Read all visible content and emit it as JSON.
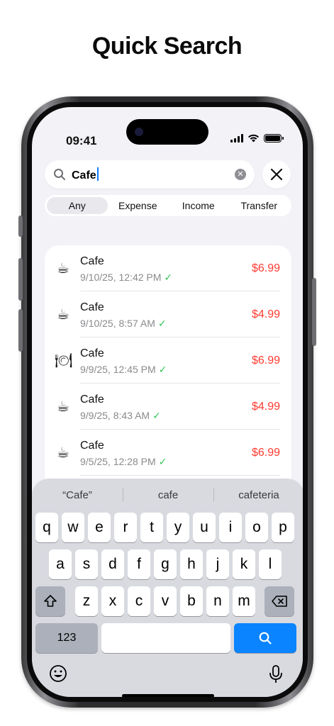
{
  "headline": "Quick Search",
  "status_bar": {
    "time": "09:41"
  },
  "search": {
    "query": "Cafe",
    "clear_icon": "x-circle-icon",
    "close_icon": "close-icon"
  },
  "filter": {
    "options": [
      "Any",
      "Expense",
      "Income",
      "Transfer"
    ],
    "selected": "Any"
  },
  "transactions": [
    {
      "icon": "☕",
      "name": "Cafe",
      "date": "9/10/25, 12:42 PM",
      "check": "✓",
      "amount": "$6.99"
    },
    {
      "icon": "☕",
      "name": "Cafe",
      "date": "9/10/25, 8:57 AM",
      "check": "✓",
      "amount": "$4.99"
    },
    {
      "icon": "🍽",
      "name": "Cafe",
      "date": "9/9/25, 12:45 PM",
      "check": "✓",
      "amount": "$6.99"
    },
    {
      "icon": "☕",
      "name": "Cafe",
      "date": "9/9/25, 8:43 AM",
      "check": "✓",
      "amount": "$4.99"
    },
    {
      "icon": "☕",
      "name": "Cafe",
      "date": "9/5/25, 12:28 PM",
      "check": "✓",
      "amount": "$6.99"
    }
  ],
  "keyboard": {
    "suggestions": [
      "“Cafe”",
      "cafe",
      "cafeteria"
    ],
    "row1": [
      "q",
      "w",
      "e",
      "r",
      "t",
      "y",
      "u",
      "i",
      "o",
      "p"
    ],
    "row2": [
      "a",
      "s",
      "d",
      "f",
      "g",
      "h",
      "j",
      "k",
      "l"
    ],
    "row3": [
      "z",
      "x",
      "c",
      "v",
      "b",
      "n",
      "m"
    ],
    "numbers_label": "123",
    "shift_icon": "shift-icon",
    "backspace_icon": "backspace-icon",
    "search_icon": "search-icon",
    "emoji_icon": "emoji-icon",
    "mic_icon": "microphone-icon"
  },
  "colors": {
    "amount": "#ff3b30",
    "check": "#34c759",
    "accent": "#0a84ff"
  }
}
